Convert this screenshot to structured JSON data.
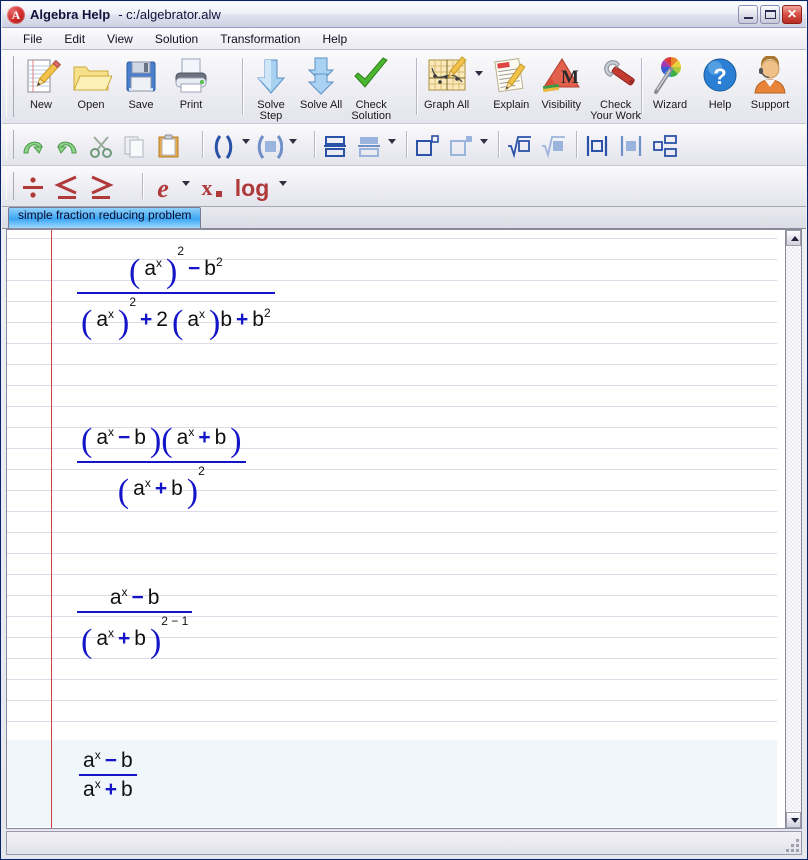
{
  "window": {
    "app_icon": "algebrator-icon",
    "title": "Algebra Help",
    "document": "- c:/algebrator.alw",
    "buttons": {
      "minimize": "minimize-button",
      "maximize": "maximize-button",
      "close_glyph": "✕"
    }
  },
  "menu": {
    "items": [
      {
        "label": "File"
      },
      {
        "label": "Edit"
      },
      {
        "label": "View"
      },
      {
        "label": "Solution"
      },
      {
        "label": "Transformation"
      },
      {
        "label": "Help"
      }
    ]
  },
  "toolbar_main": {
    "groups": [
      {
        "buttons": [
          {
            "label": "New",
            "icon": "new-document-icon"
          },
          {
            "label": "Open",
            "icon": "open-folder-icon"
          },
          {
            "label": "Save",
            "icon": "floppy-disk-icon"
          },
          {
            "label": "Print",
            "icon": "printer-icon"
          }
        ]
      },
      {
        "buttons": [
          {
            "label": "Solve\nStep",
            "icon": "down-arrow-icon"
          },
          {
            "label": "Solve All",
            "icon": "double-down-arrow-icon"
          },
          {
            "label": "Check\nSolution",
            "icon": "green-check-icon"
          }
        ]
      },
      {
        "buttons": [
          {
            "label": "Graph All",
            "icon": "graph-plot-icon",
            "has_dropdown": true
          },
          {
            "label": "Explain",
            "icon": "explain-paper-icon"
          },
          {
            "label": "Visibility",
            "icon": "visibility-m-icon"
          },
          {
            "label": "Check\nYour Work",
            "icon": "wrench-icon"
          }
        ]
      },
      {
        "buttons": [
          {
            "label": "Wizard",
            "icon": "magic-wand-icon"
          },
          {
            "label": "Help",
            "icon": "question-mark-icon"
          },
          {
            "label": "Support",
            "icon": "support-person-icon"
          }
        ]
      }
    ]
  },
  "toolbar_edit": {
    "groups": [
      {
        "buttons": [
          {
            "icon": "undo-icon"
          },
          {
            "icon": "redo-icon"
          },
          {
            "icon": "cut-scissors-icon"
          },
          {
            "icon": "copy-icon"
          },
          {
            "icon": "paste-clipboard-icon"
          }
        ]
      },
      {
        "buttons": [
          {
            "icon": "parentheses-icon"
          },
          {
            "icon": "parentheses-filled-icon",
            "has_dropdown": true
          }
        ]
      },
      {
        "buttons": [
          {
            "icon": "fraction-icon"
          },
          {
            "icon": "fraction-template-icon",
            "has_dropdown": true
          }
        ]
      },
      {
        "buttons": [
          {
            "icon": "superscript-icon"
          },
          {
            "icon": "superscript-template-icon",
            "has_dropdown": true
          }
        ]
      },
      {
        "buttons": [
          {
            "icon": "radical-icon"
          },
          {
            "icon": "radical-template-icon"
          }
        ]
      },
      {
        "buttons": [
          {
            "icon": "absolute-value-icon"
          },
          {
            "icon": "absolute-value-filled-icon"
          },
          {
            "icon": "matrix-icon"
          }
        ]
      }
    ]
  },
  "toolbar_symbols": {
    "groups": [
      {
        "buttons": [
          {
            "icon": "divide-icon",
            "glyph": "÷"
          },
          {
            "icon": "less-than-equal-icon",
            "glyph": "≤"
          },
          {
            "icon": "greater-than-equal-icon",
            "glyph": "≥"
          }
        ]
      },
      {
        "buttons": [
          {
            "icon": "exponential-e-icon",
            "glyph": "e",
            "has_dropdown": true
          },
          {
            "icon": "subscript-x-icon",
            "glyph": "x"
          },
          {
            "icon": "logarithm-icon",
            "glyph": "log",
            "has_dropdown": true
          }
        ]
      }
    ]
  },
  "tabs": {
    "items": [
      {
        "label": "simple fraction reducing problem",
        "active": true
      }
    ]
  },
  "document": {
    "paper": {
      "rule_color": "#dcdce8",
      "margin_color": "#d04040",
      "highlight_color": "#eff7fa"
    },
    "steps": [
      {
        "id": "step-1",
        "numerator": "( a^x )^2 - b^2",
        "denominator": "( a^x )^2 + 2 ( a^x ) b + b^2",
        "highlighted": false
      },
      {
        "id": "step-2",
        "numerator": "( a^x - b ) ( a^x + b )",
        "denominator": "( a^x + b )^2",
        "highlighted": false
      },
      {
        "id": "step-3",
        "numerator": "a^x - b",
        "denominator": "( a^x + b )^(2 - 1)",
        "highlighted": false
      },
      {
        "id": "step-4",
        "numerator": "a^x - b",
        "denominator": "a^x + b",
        "highlighted": true
      }
    ],
    "symbols": {
      "a": "a",
      "b": "b",
      "x": "x",
      "two": "2",
      "one": "1",
      "minus": "−",
      "plus": "+",
      "lparen": "(",
      "rparen": ")"
    }
  },
  "scrollbar": {
    "up_arrow": "scroll-up-arrow",
    "down_arrow": "scroll-down-arrow"
  }
}
